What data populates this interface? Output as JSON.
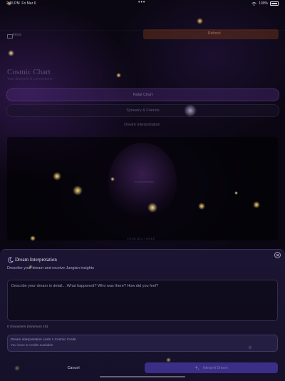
{
  "status_bar": {
    "time": "2:15 PM",
    "date": "Fri Mar 6",
    "center_dots": "•••",
    "battery_percent": "100%"
  },
  "background": {
    "inbox_label": "Inbox",
    "orange_tab_label": "Refresh",
    "title": "Cosmic Chart",
    "subtitle": "Your blueprint & connections",
    "buttons": [
      "Natal Chart",
      "Synastry & Friends",
      "Dream Interpretation"
    ],
    "globe_label": "Your Ascendant",
    "lower_label": "YOUR BIG THREE"
  },
  "modal": {
    "title": "Dream Interpretation",
    "description": "Describe your dream and receive Jungian insights",
    "input_placeholder": "Describe your dream in detail... What happened? Who was there? How did you feel?",
    "input_value": "",
    "char_count": "0 characters (minimum 10)",
    "info_line1": "Dream interpretation costs 1 Cosmic Credit",
    "info_line2": "You have 5 credits available",
    "cancel_label": "Cancel",
    "interpret_label": "Interpret Dream"
  },
  "icons": {
    "moon": "moon-icon",
    "close": "close-icon",
    "sparkles": "sparkles-icon",
    "wifi": "wifi-icon",
    "battery": "battery-icon"
  },
  "colors": {
    "modal_bg": "#1c1634",
    "accent": "#3a2e86",
    "info_text": "#9c8fd6"
  }
}
